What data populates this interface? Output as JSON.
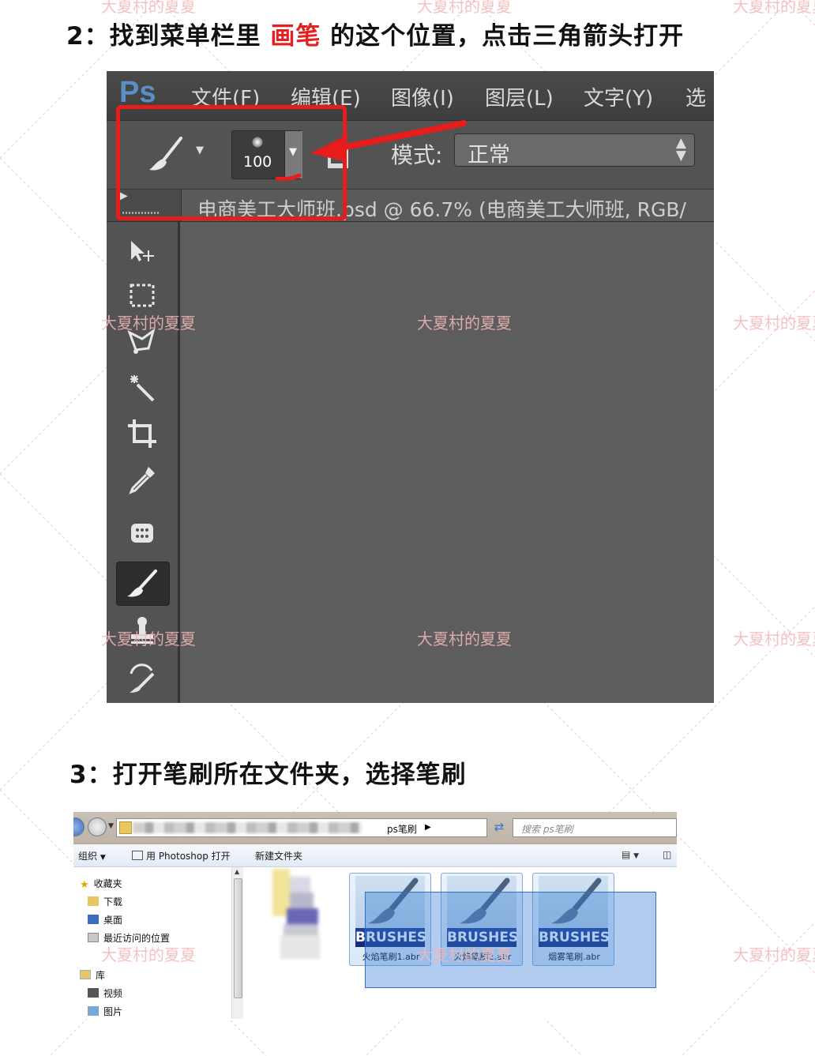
{
  "watermark": {
    "text": "大夏村的夏夏"
  },
  "step2": {
    "prefix": "2：找到菜单栏里 ",
    "highlight": "画笔",
    "suffix": " 的这个位置，点击三角箭头打开"
  },
  "step3": {
    "title": "3：打开笔刷所在文件夹，选择笔刷"
  },
  "photoshop": {
    "logo": "Ps",
    "menu": [
      "文件(F)",
      "编辑(E)",
      "图像(I)",
      "图层(L)",
      "文字(Y)",
      "选"
    ],
    "brush_size": "100",
    "mode_label": "模式:",
    "mode_value": "正常",
    "doc_tab": "电商美工大师班.psd @ 66.7% (电商美工大师班, RGB/",
    "accent_color": "#e71c1c",
    "tools": [
      "move-tool-icon",
      "marquee-tool-icon",
      "lasso-tool-icon",
      "magic-wand-tool-icon",
      "crop-tool-icon",
      "eyedropper-tool-icon",
      "healing-tool-icon",
      "brush-tool-icon",
      "stamp-tool-icon",
      "history-brush-tool-icon"
    ]
  },
  "explorer": {
    "address_last": "ps笔刷",
    "search_placeholder": "搜索 ps笔刷",
    "toolbar": {
      "organize": "组织",
      "open_with": "用 Photoshop 打开",
      "new_folder": "新建文件夹"
    },
    "nav": {
      "favorites": "收藏夹",
      "downloads": "下载",
      "desktop": "桌面",
      "recent": "最近访问的位置",
      "libraries": "库",
      "videos": "视频",
      "pictures": "图片"
    },
    "files": [
      {
        "badge": "BRUSHES",
        "name": "火焰笔刷1.abr"
      },
      {
        "badge": "BRUSHES",
        "name": "火焰笔刷2.abr"
      },
      {
        "badge": "BRUSHES",
        "name": "烟雾笔刷.abr"
      }
    ]
  }
}
